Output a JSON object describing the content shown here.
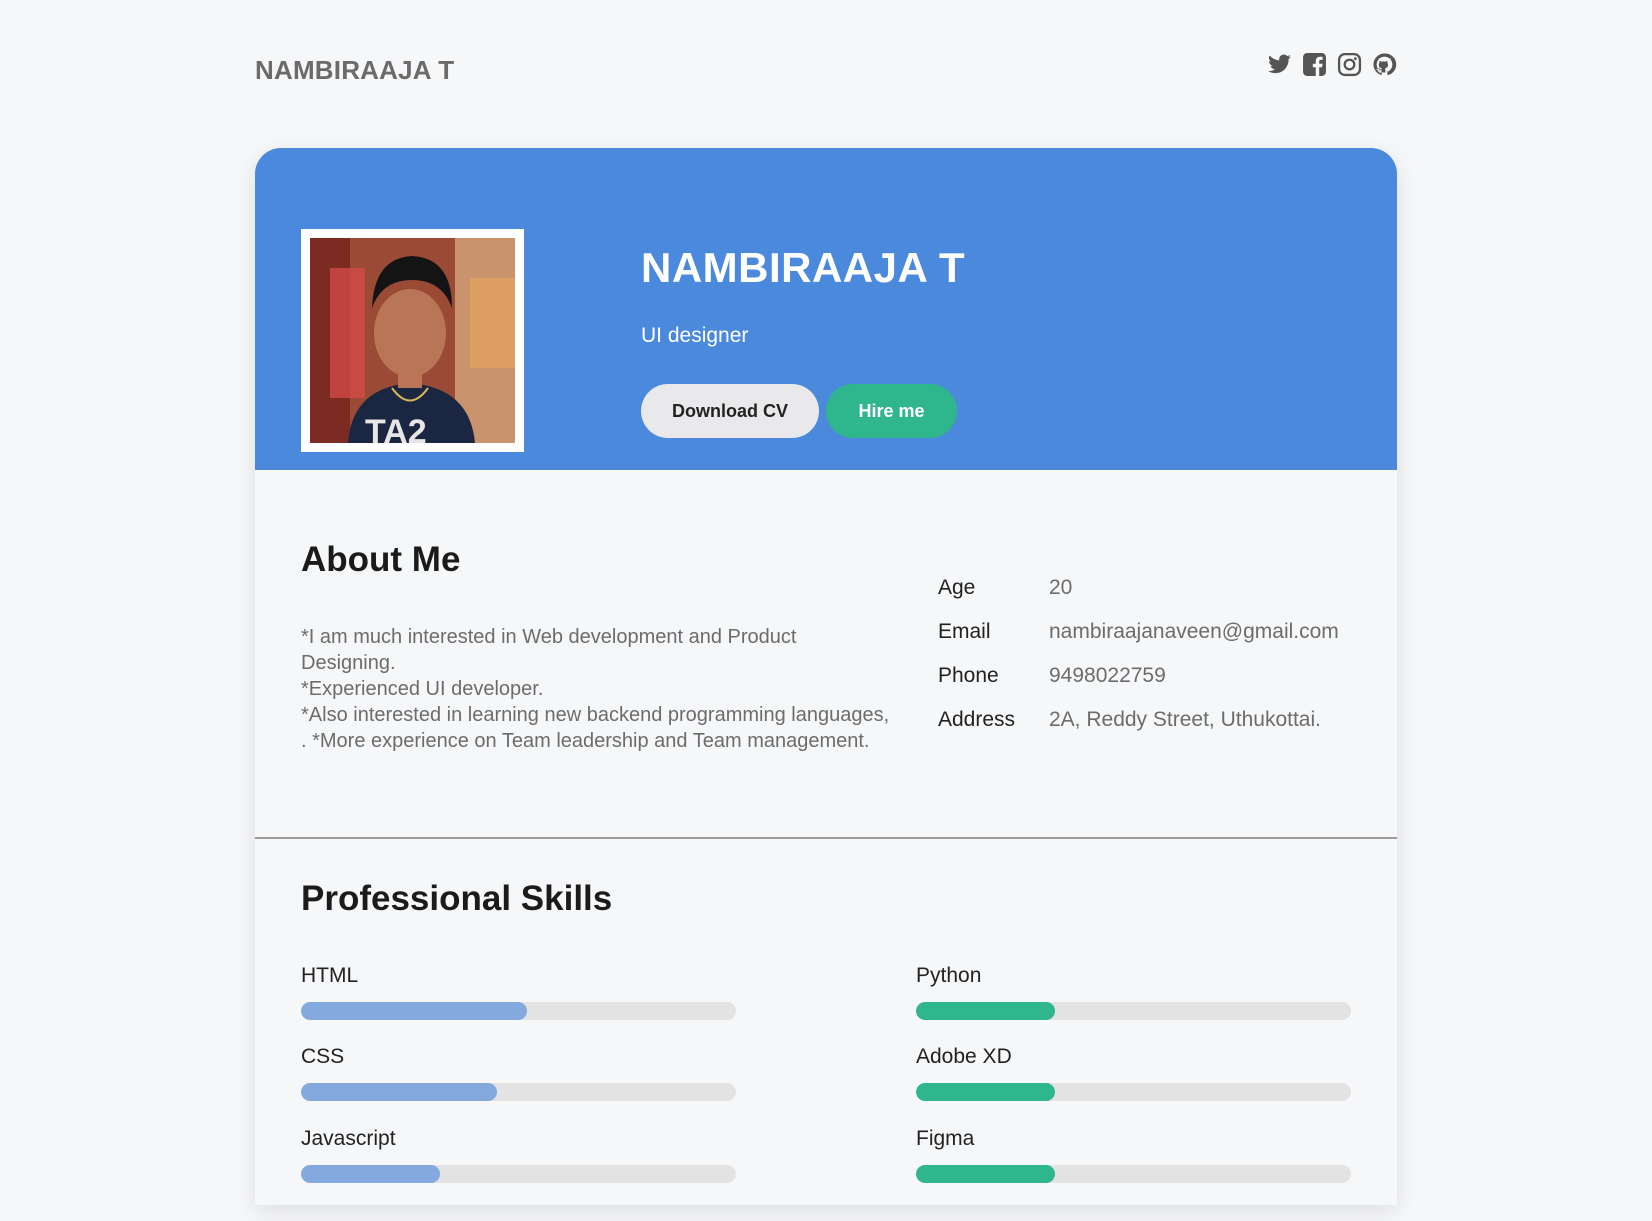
{
  "header": {
    "brand": "NAMBIRAAJA T",
    "social_icons": [
      "twitter-icon",
      "facebook-icon",
      "instagram-icon",
      "github-icon"
    ]
  },
  "hero": {
    "name": "NAMBIRAAJA T",
    "role": "UI designer",
    "download_cv_label": "Download CV",
    "hire_me_label": "Hire me"
  },
  "about": {
    "title": "About Me",
    "lines": [
      "*I am much interested in Web development and Product Designing.",
      "*Experienced UI developer.",
      "*Also interested in learning new backend programming languages, . *More experience on Team leadership and Team management."
    ],
    "info": [
      {
        "label": "Age",
        "value": "20"
      },
      {
        "label": "Email",
        "value": "nambiraajanaveen@gmail.com"
      },
      {
        "label": "Phone",
        "value": "9498022759"
      },
      {
        "label": "Address",
        "value": "2A, Reddy Street, Uthukottai."
      }
    ]
  },
  "skills": {
    "title": "Professional Skills",
    "left": [
      {
        "name": "HTML",
        "level": 0.52
      },
      {
        "name": "CSS",
        "level": 0.45
      },
      {
        "name": "Javascript",
        "level": 0.32
      }
    ],
    "right": [
      {
        "name": "Python",
        "level": 0.32
      },
      {
        "name": "Adobe XD",
        "level": 0.32
      },
      {
        "name": "Figma",
        "level": 0.32
      }
    ]
  },
  "colors": {
    "hero_bg": "#4a89dc",
    "accent_green": "#2fb68c",
    "skill_blue": "#84a9df",
    "skill_green": "#2fb68c",
    "track": "#e3e3e4"
  }
}
